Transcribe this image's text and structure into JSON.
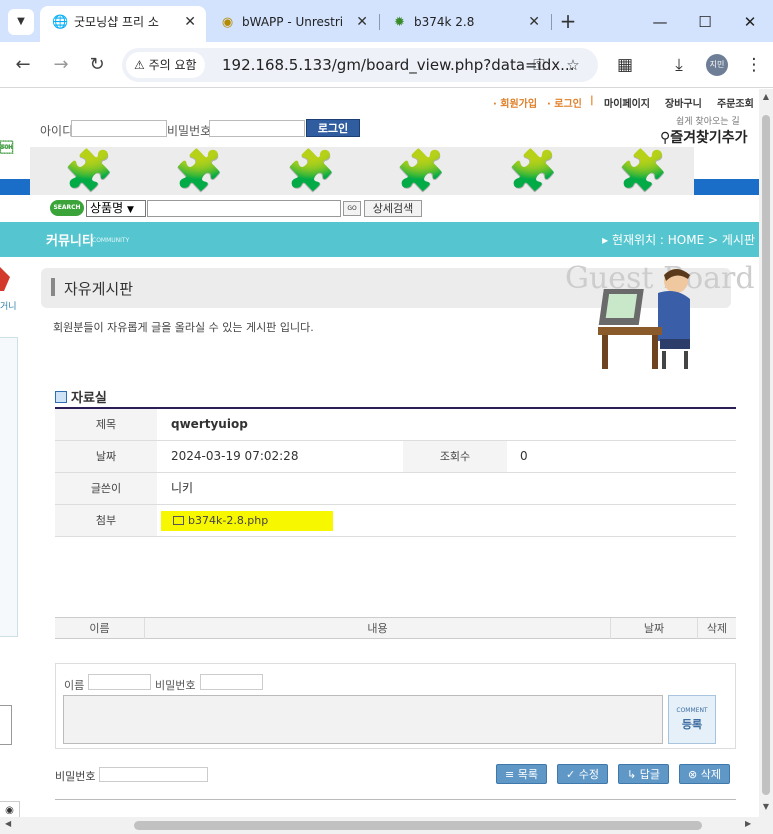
{
  "browser": {
    "tabs": [
      {
        "title": "굿모닝샵 프리 소",
        "active": true
      },
      {
        "title": "bWAPP - Unrestri",
        "active": false
      },
      {
        "title": "b374k 2.8",
        "active": false
      }
    ],
    "security_chip": "주의 요함",
    "url": "192.168.5.133/gm/board_view.php?data=idx...",
    "profile_initials": "지민"
  },
  "site": {
    "top_menu": {
      "join": "· 회원가입",
      "login": "· 로그인",
      "sep": "|",
      "mypage": "마이페이지",
      "cart": "장바구니",
      "order": "주문조회"
    },
    "login": {
      "id_label": "아이디",
      "pw_label": "비밀번호",
      "button": "로그인"
    },
    "bookmark": {
      "small": "쉽게 찾아오는 길",
      "big": "즐겨찾기추가"
    },
    "search": {
      "logo": "SEARCH",
      "category": "상품명",
      "go": "GO",
      "advanced": "상세검색"
    },
    "community": {
      "title": "커뮤니티",
      "subtitle": "COMMUNITY",
      "location": "현재위치 : HOME > 게시판"
    },
    "left_fragment": "거니"
  },
  "board": {
    "title": "자유게시판",
    "watermark": "Guest Board",
    "description": "회원분들이 자유롭게 글을 올라실 수 있는 게시판 입니다.",
    "section": "자료실",
    "post": {
      "subject_label": "제목",
      "subject": "qwertyuiop",
      "date_label": "날짜",
      "date": "2024-03-19 07:02:28",
      "views_label": "조회수",
      "views": "0",
      "author_label": "글쓴이",
      "author": "니키",
      "attachment_label": "첨부",
      "attachment": "b374k-2.8.php"
    },
    "comments": {
      "col_name": "이름",
      "col_content": "내용",
      "col_date": "날짜",
      "col_delete": "삭제",
      "name_label": "이름",
      "pw_label": "비밀번호",
      "submit_small": "COMMENT",
      "submit": "등록"
    },
    "footer": {
      "pw_label": "비밀번호",
      "list": "목록",
      "edit": "수정",
      "reply": "답글",
      "delete": "삭제"
    }
  }
}
